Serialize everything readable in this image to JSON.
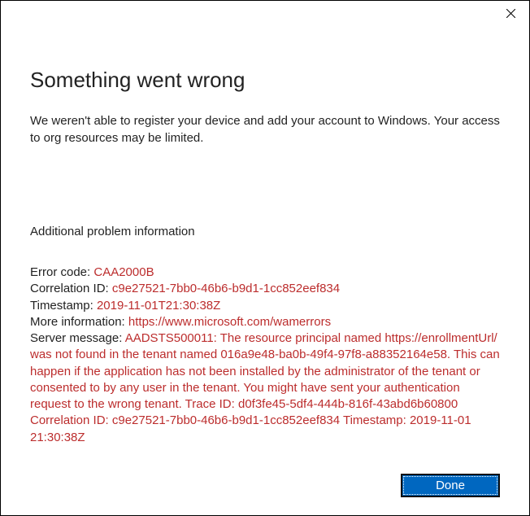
{
  "dialog": {
    "title": "Something went wrong",
    "message": "We weren't able to register your device and add your account to Windows. Your access to org resources may be limited.",
    "additional_label": "Additional problem information",
    "error_code_label": "Error code: ",
    "error_code": "CAA2000B",
    "correlation_label": "Correlation ID: ",
    "correlation_id": "c9e27521-7bb0-46b6-b9d1-1cc852eef834",
    "timestamp_label": "Timestamp: ",
    "timestamp": "2019-11-01T21:30:38Z",
    "more_info_label": "More information: ",
    "more_info_url": "https://www.microsoft.com/wamerrors",
    "server_message_label": "Server message: ",
    "server_message": "AADSTS500011: The resource principal named https://enrollmentUrl/ was not found in the tenant named 016a9e48-ba0b-49f4-97f8-a88352164e58. This can happen if the application has not been installed by the administrator of the tenant or consented to by any user in the tenant. You might have sent your authentication request to the wrong tenant. Trace ID: d0f3fe45-5df4-444b-816f-43abd6b60800 Correlation ID: c9e27521-7bb0-46b6-b9d1-1cc852eef834 Timestamp: 2019-11-01 21:30:38Z",
    "done_button": "Done"
  }
}
